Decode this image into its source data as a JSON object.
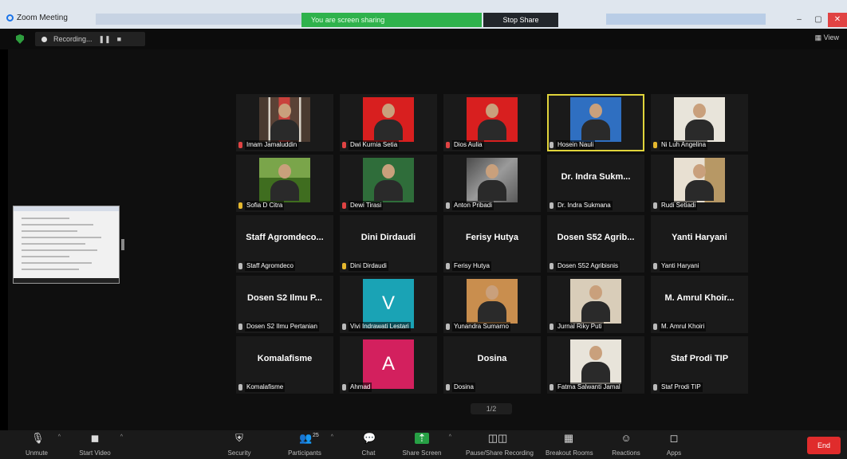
{
  "window": {
    "app_title": "Zoom Meeting",
    "share_banner": "You are screen sharing",
    "stop_share": "Stop Share",
    "controls": [
      "–",
      "▢",
      "✕"
    ]
  },
  "meeting_bar": {
    "recording_label": "Recording...",
    "view_label": "View"
  },
  "thumbnail": {
    "icon": "document-preview"
  },
  "participants": [
    {
      "name": "",
      "label": "Imam Jamaluddin",
      "photo": "ph-curtain",
      "mic": "muted"
    },
    {
      "name": "",
      "label": "Dwi Kurnia Setia",
      "photo": "ph-red",
      "mic": "muted"
    },
    {
      "name": "",
      "label": "Dios Aulia",
      "photo": "ph-red",
      "mic": "muted"
    },
    {
      "name": "",
      "label": "Hosein Nauli",
      "photo": "ph-blue",
      "mic": "on",
      "speaking": true
    },
    {
      "name": "",
      "label": "Ni Luh Angelina",
      "photo": "ph-wall",
      "mic": "active"
    },
    {
      "name": "",
      "label": "Sofia D Citra",
      "photo": "ph-grass",
      "mic": "active"
    },
    {
      "name": "",
      "label": "Dewi Tirasi",
      "photo": "ph-green",
      "mic": "muted"
    },
    {
      "name": "",
      "label": "Anton Pribadi",
      "photo": "ph-mono",
      "mic": "on"
    },
    {
      "name": "Dr. Indra Sukm...",
      "label": "Dr. Indra Sukmana",
      "photo": null,
      "mic": "on"
    },
    {
      "name": "",
      "label": "Rudi Setiadi",
      "photo": "ph-room",
      "mic": "on"
    },
    {
      "name": "Staff Agromdeco...",
      "label": "Staff Agromdeco",
      "photo": null,
      "mic": "on"
    },
    {
      "name": "Dini Dirdaudi",
      "label": "Dini Dirdaudi",
      "photo": null,
      "mic": "active"
    },
    {
      "name": "Ferisy Hutya",
      "label": "Ferisy Hutya",
      "photo": null,
      "mic": "on"
    },
    {
      "name": "Dosen S52 Agrib...",
      "label": "Dosen S52 Agribisnis",
      "photo": null,
      "mic": "on"
    },
    {
      "name": "Yanti Haryani",
      "label": "Yanti Haryani",
      "photo": null,
      "mic": "on"
    },
    {
      "name": "Dosen S2 Ilmu P...",
      "label": "Dosen S2 Ilmu Pertanian",
      "photo": null,
      "mic": "on"
    },
    {
      "name": "",
      "label": "Vivi Indrawati Lestari",
      "avatar": "V",
      "avatar_color": "#1aa3b5",
      "mic": "on"
    },
    {
      "name": "",
      "label": "Yunandra Sumarno",
      "photo": "ph-warm",
      "mic": "on"
    },
    {
      "name": "",
      "label": "Jurnal Riky Puti",
      "photo": "ph-pale",
      "mic": "on"
    },
    {
      "name": "M. Amrul Khoir...",
      "label": "M. Amrul Khoiri",
      "photo": null,
      "mic": "on"
    },
    {
      "name": "Komalafisme",
      "label": "Komalafisme",
      "photo": null,
      "mic": "on"
    },
    {
      "name": "",
      "label": "Ahmad",
      "avatar": "A",
      "avatar_color": "#d3205e",
      "mic": "on"
    },
    {
      "name": "Dosina",
      "label": "Dosina",
      "photo": null,
      "mic": "on"
    },
    {
      "name": "",
      "label": "Fatma Salwanti Jamal",
      "photo": "ph-wall",
      "mic": "on"
    },
    {
      "name": "Staf Prodi TIP",
      "label": "Staf Prodi TIP",
      "photo": null,
      "mic": "on"
    }
  ],
  "page_indicator": "1/2",
  "toolbar": {
    "unmute": "Unmute",
    "start_video": "Start Video",
    "security": "Security",
    "participants": "Participants",
    "participants_count": "25",
    "chat": "Chat",
    "share_screen": "Share Screen",
    "pause_share": "Pause/Share Recording",
    "breakout": "Breakout Rooms",
    "reactions": "Reactions",
    "apps": "Apps",
    "end": "End"
  }
}
